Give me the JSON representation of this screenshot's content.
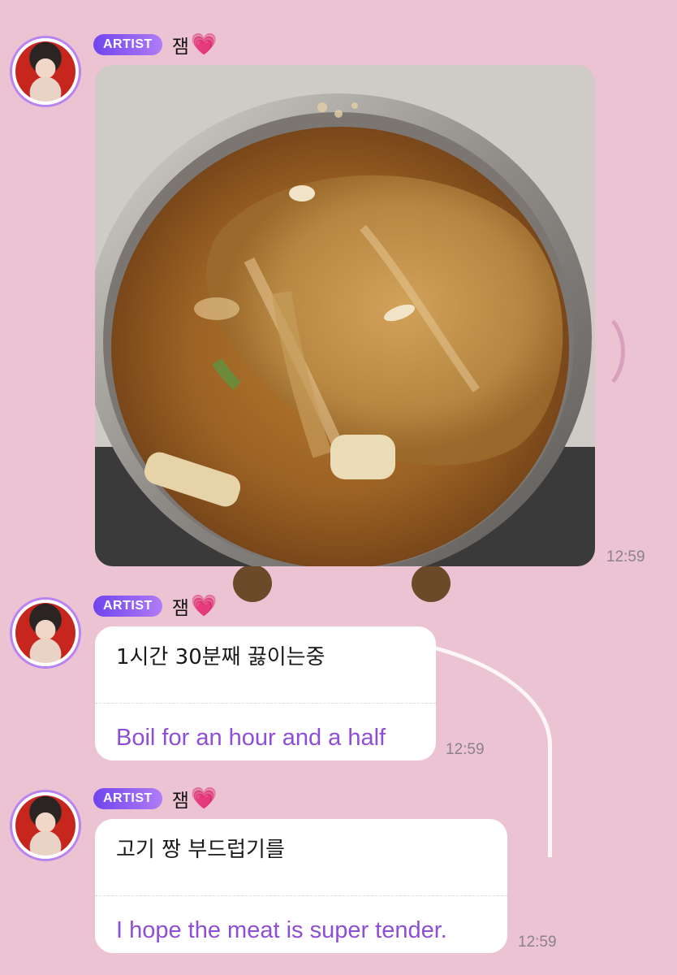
{
  "messages": [
    {
      "badge": "ARTIST",
      "sender": "잼",
      "heart": "💗",
      "type": "photo",
      "time": "12:59"
    },
    {
      "badge": "ARTIST",
      "sender": "잼",
      "heart": "💗",
      "type": "text",
      "original": "1시간 30분째 끓이는중",
      "translation": "Boil for an hour and a half",
      "time": "12:59"
    },
    {
      "badge": "ARTIST",
      "sender": "잼",
      "heart": "💗",
      "type": "text",
      "original": "고기 짱 부드럽기를",
      "translation": "I hope the meat is super tender.",
      "time": "12:59"
    }
  ],
  "colors": {
    "background": "#ecc3d3",
    "badge_gradient_start": "#6f45ee",
    "badge_gradient_end": "#b07bf6",
    "translation_text": "#8e4fd4",
    "avatar_ring": "#b884f0"
  }
}
